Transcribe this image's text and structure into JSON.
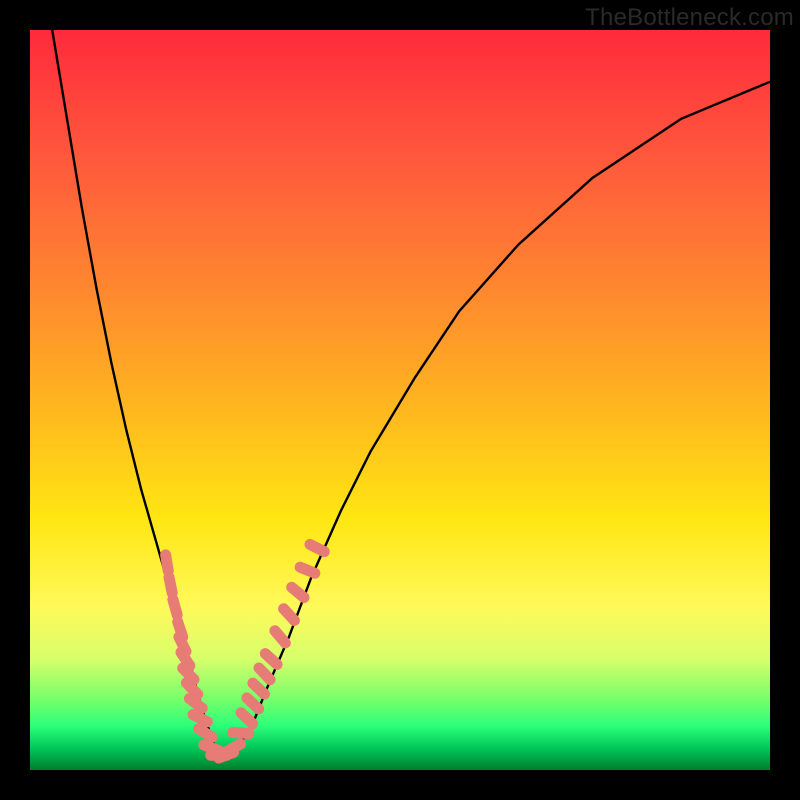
{
  "watermark": "TheBottleneck.com",
  "colors": {
    "curve_stroke": "#000000",
    "marker_fill": "#e77b75",
    "frame_bg": "#000000"
  },
  "chart_data": {
    "type": "line",
    "title": "",
    "xlabel": "",
    "ylabel": "",
    "xlim": [
      0,
      100
    ],
    "ylim": [
      0,
      100
    ],
    "series": [
      {
        "name": "bottleneck-curve",
        "x": [
          3,
          5,
          7,
          9,
          11,
          13,
          15,
          17,
          19,
          21,
          22,
          23,
          24,
          25,
          26,
          27,
          28,
          30,
          32,
          35,
          38,
          42,
          46,
          52,
          58,
          66,
          76,
          88,
          100
        ],
        "y": [
          100,
          88,
          76,
          65,
          55,
          46,
          38,
          31,
          24,
          17,
          13,
          9,
          6,
          3,
          2,
          2,
          3,
          6,
          11,
          18,
          26,
          35,
          43,
          53,
          62,
          71,
          80,
          88,
          93
        ]
      }
    ],
    "markers": [
      {
        "name": "left-band-marker",
        "x": 18.5,
        "y": 28
      },
      {
        "name": "left-band-marker",
        "x": 19.0,
        "y": 25
      },
      {
        "name": "left-band-marker",
        "x": 19.6,
        "y": 22
      },
      {
        "name": "left-band-marker",
        "x": 20.3,
        "y": 19
      },
      {
        "name": "left-band-marker",
        "x": 20.6,
        "y": 17
      },
      {
        "name": "left-band-marker",
        "x": 21.0,
        "y": 15
      },
      {
        "name": "left-band-marker",
        "x": 21.4,
        "y": 13
      },
      {
        "name": "left-band-marker",
        "x": 21.9,
        "y": 11
      },
      {
        "name": "left-band-marker",
        "x": 22.4,
        "y": 9
      },
      {
        "name": "left-band-marker",
        "x": 23.0,
        "y": 7
      },
      {
        "name": "left-band-marker",
        "x": 23.7,
        "y": 5
      },
      {
        "name": "bottom-marker",
        "x": 24.5,
        "y": 3
      },
      {
        "name": "bottom-marker",
        "x": 25.5,
        "y": 2
      },
      {
        "name": "bottom-marker",
        "x": 26.5,
        "y": 2
      },
      {
        "name": "bottom-marker",
        "x": 27.5,
        "y": 3
      },
      {
        "name": "right-band-marker",
        "x": 28.5,
        "y": 5
      },
      {
        "name": "right-band-marker",
        "x": 29.3,
        "y": 7
      },
      {
        "name": "right-band-marker",
        "x": 30.1,
        "y": 9
      },
      {
        "name": "right-band-marker",
        "x": 30.9,
        "y": 11
      },
      {
        "name": "right-band-marker",
        "x": 31.7,
        "y": 13
      },
      {
        "name": "right-band-marker",
        "x": 32.6,
        "y": 15
      },
      {
        "name": "right-band-marker",
        "x": 33.8,
        "y": 18
      },
      {
        "name": "right-band-marker",
        "x": 35.0,
        "y": 21
      },
      {
        "name": "right-band-marker",
        "x": 36.2,
        "y": 24
      },
      {
        "name": "right-band-marker",
        "x": 37.5,
        "y": 27
      },
      {
        "name": "right-band-marker",
        "x": 38.8,
        "y": 30
      }
    ]
  }
}
